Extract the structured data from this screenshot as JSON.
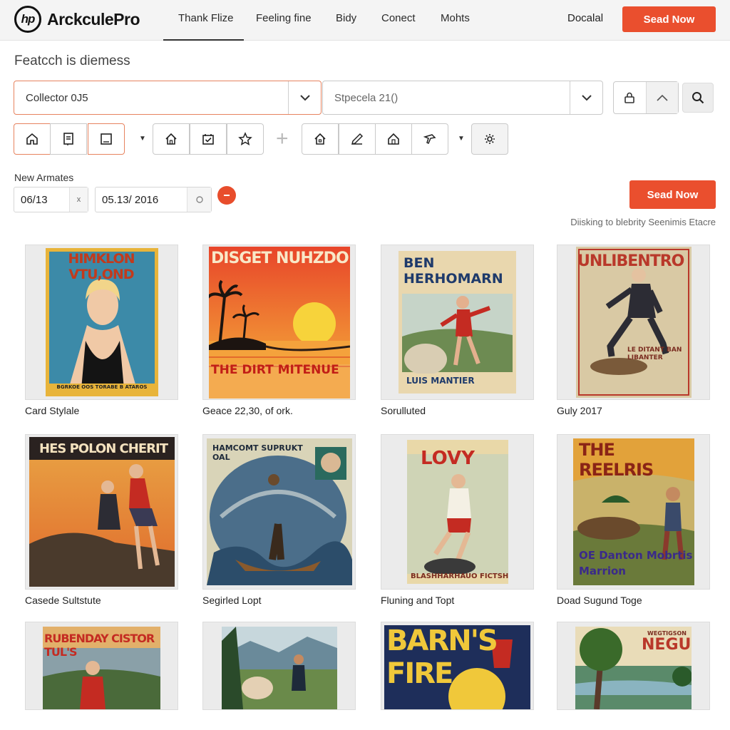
{
  "app": {
    "brand": "ArckculePro",
    "logo_mark": "hp"
  },
  "nav": {
    "items": [
      "Thank Flize",
      "Feeling fine",
      "Bidy",
      "Conect",
      "Mohts"
    ],
    "right_link": "Docalal",
    "cta": "Sead Now"
  },
  "search": {
    "heading": "Featcch is diemess",
    "select_1": "Collector 0J5",
    "select_2": "Stpecela 21()"
  },
  "filters": {
    "date_label": "New Armates",
    "date_from": "06/13",
    "date_to": "05.13/ 2016",
    "cta": "Sead Now",
    "display_note": "Diisking to blebrity Seenimis Etacre"
  },
  "icons": {
    "logo": "logo-icon",
    "chevron": "chevron-down-icon",
    "lock": "lock-icon",
    "search": "search-icon",
    "clear": "close-icon"
  },
  "colors": {
    "accent": "#ea4f2e",
    "accent_border": "#e7835f"
  },
  "posters": [
    {
      "caption": "Card Stylale",
      "title": "HIMKLON VTU,OND",
      "bottom": "BGRKOE OOS TORABE B ATAROS"
    },
    {
      "caption": "Geace 22,30, of ork.",
      "title": "DISGET NUHZDO",
      "bottom": "THE DIRT MITENUE"
    },
    {
      "caption": "Sorulluted",
      "title": "BEN HERHOMARN",
      "bottom": "LUIS MANTIER"
    },
    {
      "caption": "Guly 2017",
      "title": "UNLIBENTRO",
      "bottom": "LE DITANT BAN LIBANTER"
    },
    {
      "caption": "Casede Sultstute",
      "title": "HES POLON CHERIT",
      "bottom": ""
    },
    {
      "caption": "Segirled Lopt",
      "title": "HAMCOMT SUPRUKT OAL",
      "bottom": ""
    },
    {
      "caption": "Fluning and Topt",
      "title": "LOVY",
      "bottom": "BLASHHARHAUO FICTSH"
    },
    {
      "caption": "Doad Sugund Toge",
      "title": "THE REELRIS",
      "bottom": "OE Danton Mobrtis Marrion"
    },
    {
      "caption": "",
      "title": "RUBENDAY CISTOR TUL'S",
      "bottom": ""
    },
    {
      "caption": "",
      "title": "",
      "bottom": ""
    },
    {
      "caption": "",
      "title": "BARN'S FIRE",
      "bottom": ""
    },
    {
      "caption": "",
      "title": "NEGU",
      "bottom": "WEGTIGSON"
    }
  ]
}
